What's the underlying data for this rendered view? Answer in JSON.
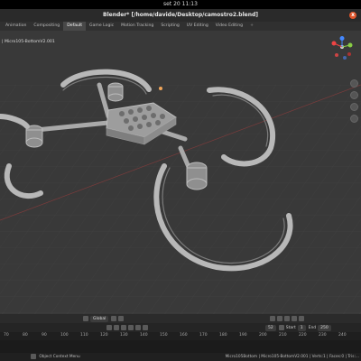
{
  "os_bar": {
    "datetime": "set 20  11:13"
  },
  "window": {
    "title": "Blender* [/home/davide/Desktop/camostro2.blend]",
    "close_glyph": "x"
  },
  "tabs": [
    {
      "label": "Animation"
    },
    {
      "label": "Compositing"
    },
    {
      "label": "Default"
    },
    {
      "label": "Game Logic"
    },
    {
      "label": "Motion Tracking"
    },
    {
      "label": "Scripting"
    },
    {
      "label": "UV Editing"
    },
    {
      "label": "Video Editing"
    },
    {
      "label": "+"
    }
  ],
  "viewport": {
    "object_label": "| Micro105-BottomV2.001"
  },
  "viewport_header": {
    "orientation": "Global",
    "icons": [
      "view-icon",
      "snap-icon",
      "proportional-icon",
      "overlay-icon",
      "shading-icon"
    ]
  },
  "timeline": {
    "start_label": "Start",
    "start_value": "1",
    "end_label": "End",
    "end_value": "250",
    "current_frame": "52"
  },
  "ruler": {
    "ticks": [
      "70",
      "80",
      "90",
      "100",
      "110",
      "120",
      "130",
      "140",
      "150",
      "160",
      "170",
      "180",
      "190",
      "200",
      "210",
      "220",
      "230",
      "240"
    ]
  },
  "statusbar": {
    "left": "Object Context Menu",
    "right": "Micro105Bottom | Micro105-BottomV2.001 | Verts:1 | Faces:0 | Tris:..."
  },
  "colors": {
    "accent": "#e0552b",
    "active_tab": "#484848",
    "viewport_bg": "#393939"
  }
}
